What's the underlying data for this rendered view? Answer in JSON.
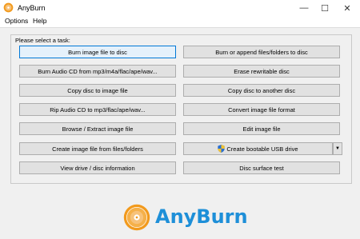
{
  "window": {
    "title": "AnyBurn",
    "icon": "anyburn-disc-icon",
    "controls": {
      "minimize": "—",
      "maximize": "☐",
      "close": "✕"
    }
  },
  "menu": {
    "options": "Options",
    "help": "Help"
  },
  "main": {
    "prompt": "Please select a task:",
    "left_buttons": [
      "Burn image file to disc",
      "Burn Audio CD from mp3/m4a/flac/ape/wav...",
      "Copy disc to image file",
      "Rip Audio CD to mp3/flac/ape/wav...",
      "Browse / Extract image file",
      "Create image file from files/folders",
      "View drive / disc information"
    ],
    "right_buttons": [
      "Burn or append files/folders to disc",
      "Erase rewritable disc",
      "Copy disc to another disc",
      "Convert image file format",
      "Edit image file",
      "Create bootable USB drive",
      "Disc surface test"
    ],
    "dropdown_arrow": "▼"
  },
  "branding": {
    "name": "AnyBurn",
    "color": "#1e8fd8",
    "accent": "#f29a1d"
  }
}
